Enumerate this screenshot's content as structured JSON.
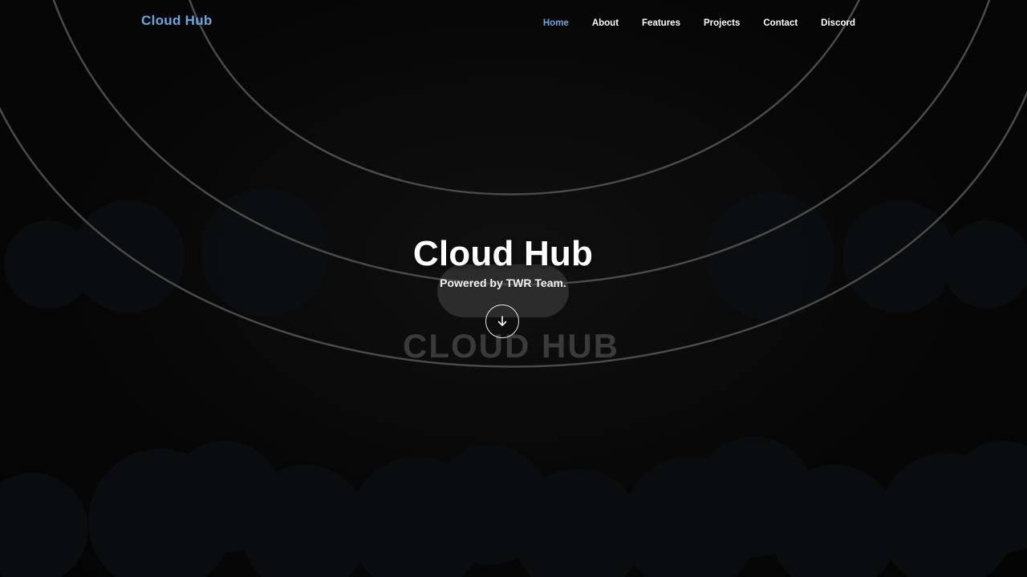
{
  "header": {
    "brand": "Cloud Hub",
    "nav": [
      {
        "label": "Home",
        "active": true
      },
      {
        "label": "About",
        "active": false
      },
      {
        "label": "Features",
        "active": false
      },
      {
        "label": "Projects",
        "active": false
      },
      {
        "label": "Contact",
        "active": false
      },
      {
        "label": "Discord",
        "active": false
      }
    ]
  },
  "hero": {
    "title": "Cloud Hub",
    "subtitle": "Powered by TWR Team.",
    "watermark": "CLOUD HUB",
    "scroll_icon": "arrow-down-icon"
  },
  "colors": {
    "accent": "#6aa6e0",
    "background": "#050505",
    "text": "#ffffff"
  }
}
